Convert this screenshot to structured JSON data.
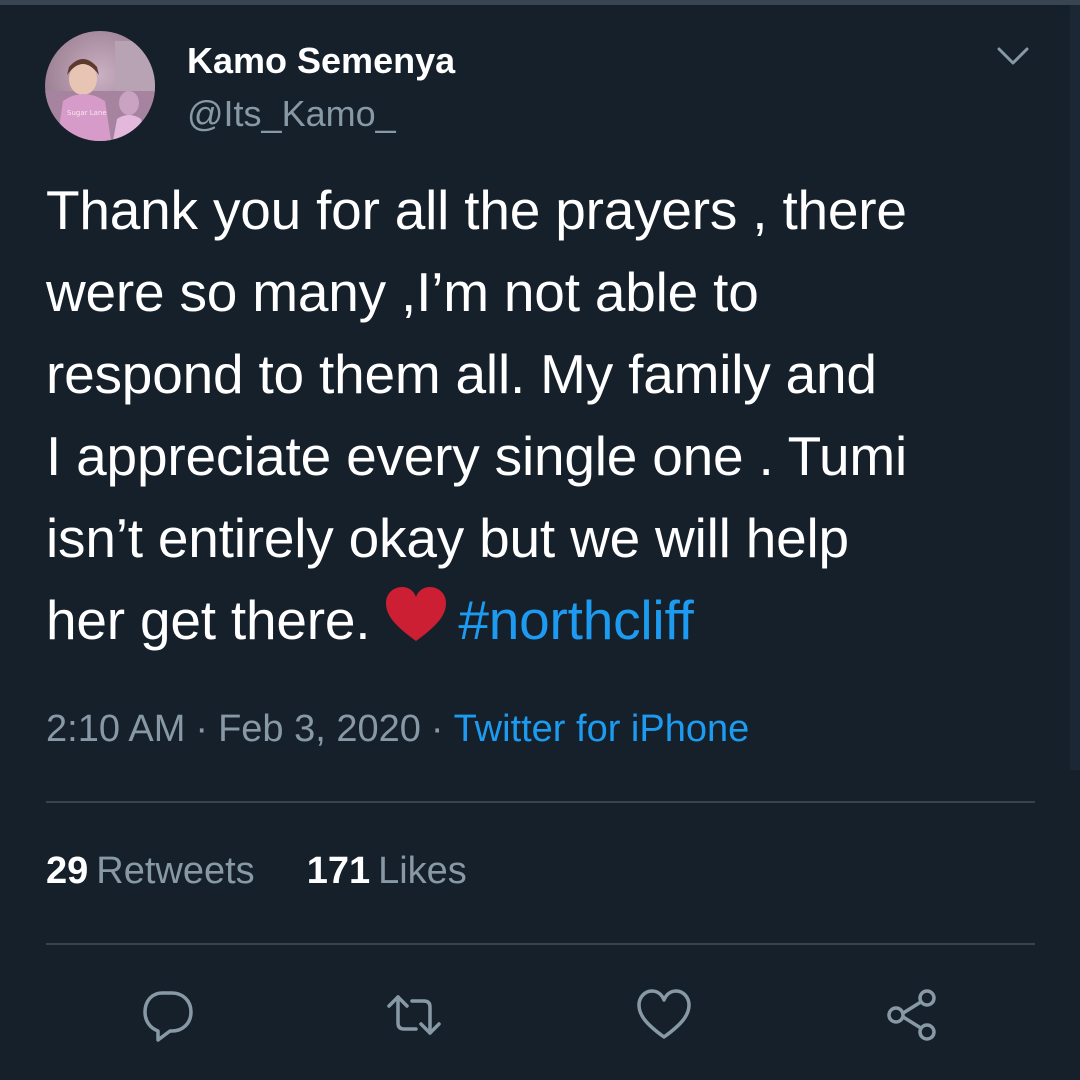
{
  "user": {
    "display_name": "Kamo Semenya",
    "handle": "@Its_Kamo_"
  },
  "tweet": {
    "lines": [
      "Thank you for all the prayers , there",
      "were so many ,I’m not able to",
      "respond to them all. My family and",
      "I appreciate every single one . Tumi",
      "isn’t entirely okay but we will help"
    ],
    "last_line": "her get there.",
    "emoji": "red-heart-emoji",
    "hashtag": "#northcliff"
  },
  "meta": {
    "time": "2:10 AM",
    "date": "Feb 3, 2020",
    "separator": "·",
    "source": "Twitter for iPhone"
  },
  "stats": {
    "retweets_count": "29",
    "retweets_label": "Retweets",
    "likes_count": "171",
    "likes_label": "Likes"
  },
  "actions": {
    "reply_icon": "reply-icon",
    "retweet_icon": "retweet-icon",
    "like_icon": "like-icon",
    "share_icon": "share-icon"
  },
  "colors": {
    "background": "#15202b",
    "text": "#ffffff",
    "secondary_text": "#8899a6",
    "link": "#1d9bf0",
    "divider": "#38444d",
    "heart": "#e0245e"
  }
}
